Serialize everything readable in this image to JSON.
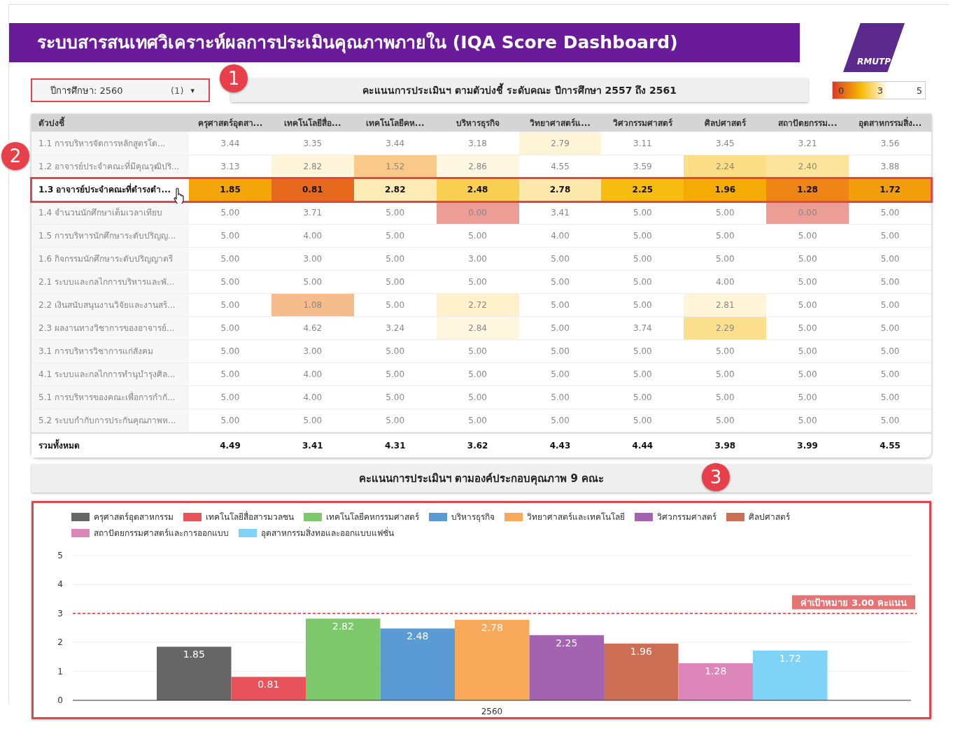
{
  "header": {
    "title": "ระบบสารสนเทศวิเคราะห์ผลการประเมินคุณภาพภายใน (IQA Score Dashboard)",
    "logo": "RMUTP"
  },
  "filter": {
    "label": "ปีการศึกษา: 2560",
    "count": "(1)",
    "caret": "▾"
  },
  "table_title": "คะแนนการประเมินฯ ตามตัวบ่งชี้ ระดับคณะ ปีการศึกษา 2557 ถึง 2561",
  "color_scale": {
    "labels": [
      "0",
      "3",
      "5"
    ]
  },
  "table": {
    "columns": [
      "ตัวบ่งชี้",
      "ครุศาสตร์อุตสา...",
      "เทคโนโลยีสื่อ...",
      "เทคโนโลยีคห...",
      "บริหารธุรกิจ",
      "วิทยาศาสตร์แ...",
      "วิศวกรรมศาสตร์",
      "ศิลปศาสตร์",
      "สถาปัตยกรรม...",
      "อุตสาหกรรมสิ่ง..."
    ],
    "rows": [
      {
        "label": "1.1 การบริหารจัดการหลักสูตรโด...",
        "selected": false,
        "values": [
          "3.44",
          "3.35",
          "3.44",
          "3.18",
          "2.79",
          "3.11",
          "3.45",
          "3.21",
          "3.56"
        ]
      },
      {
        "label": "1.2 อาจารย์ประจำคณะที่มีคุณวุฒิปริ...",
        "selected": false,
        "values": [
          "3.13",
          "2.82",
          "1.52",
          "2.86",
          "4.55",
          "3.59",
          "2.24",
          "2.40",
          "3.88"
        ]
      },
      {
        "label": "1.3 อาจารย์ประจำคณะที่ดำรงตำ...",
        "selected": true,
        "values": [
          "1.85",
          "0.81",
          "2.82",
          "2.48",
          "2.78",
          "2.25",
          "1.96",
          "1.28",
          "1.72"
        ]
      },
      {
        "label": "1.4 จำนวนนักศึกษาเต็มเวลาเทียบ",
        "selected": false,
        "values": [
          "5.00",
          "3.71",
          "5.00",
          "0.00",
          "3.41",
          "5.00",
          "5.00",
          "0.00",
          "5.00"
        ]
      },
      {
        "label": "1.5 การบริหารนักศึกษาระดับปริญญ...",
        "selected": false,
        "values": [
          "5.00",
          "4.00",
          "5.00",
          "5.00",
          "4.00",
          "5.00",
          "5.00",
          "5.00",
          "5.00"
        ]
      },
      {
        "label": "1.6 กิจกรรมนักศึกษาระดับปริญญาตรี",
        "selected": false,
        "values": [
          "5.00",
          "3.00",
          "5.00",
          "3.00",
          "5.00",
          "5.00",
          "5.00",
          "5.00",
          "5.00"
        ]
      },
      {
        "label": "2.1 ระบบและกลไกการบริหารและพั...",
        "selected": false,
        "values": [
          "5.00",
          "5.00",
          "5.00",
          "5.00",
          "5.00",
          "5.00",
          "4.00",
          "5.00",
          "5.00"
        ]
      },
      {
        "label": "2.2 เงินสนับสนุนงานวิจัยและงานสร้...",
        "selected": false,
        "values": [
          "5.00",
          "1.08",
          "5.00",
          "2.72",
          "5.00",
          "5.00",
          "2.81",
          "5.00",
          "5.00"
        ]
      },
      {
        "label": "2.3 ผลงานทางวิชาการของอาจารย์...",
        "selected": false,
        "values": [
          "5.00",
          "4.62",
          "3.24",
          "2.84",
          "5.00",
          "3.74",
          "2.29",
          "5.00",
          "5.00"
        ]
      },
      {
        "label": "3.1 การบริหารวิชาการแก่สังคม",
        "selected": false,
        "values": [
          "5.00",
          "3.00",
          "5.00",
          "5.00",
          "5.00",
          "5.00",
          "5.00",
          "5.00",
          "5.00"
        ]
      },
      {
        "label": "4.1 ระบบและกลไกการทำนุบำรุงศิล...",
        "selected": false,
        "values": [
          "5.00",
          "4.00",
          "5.00",
          "5.00",
          "5.00",
          "5.00",
          "5.00",
          "5.00",
          "5.00"
        ]
      },
      {
        "label": "5.1 การบริหารของคณะเพื่อการกำกั...",
        "selected": false,
        "values": [
          "5.00",
          "4.00",
          "5.00",
          "5.00",
          "5.00",
          "5.00",
          "5.00",
          "5.00",
          "5.00"
        ]
      },
      {
        "label": "5.2 ระบบกำกับการประกันคุณภาพห...",
        "selected": false,
        "values": [
          "5.00",
          "5.00",
          "5.00",
          "5.00",
          "5.00",
          "5.00",
          "5.00",
          "5.00",
          "5.00"
        ]
      }
    ],
    "total": {
      "label": "รวมทั้งหมด",
      "values": [
        "4.49",
        "3.41",
        "4.31",
        "3.62",
        "4.43",
        "4.44",
        "3.98",
        "3.99",
        "4.55"
      ]
    }
  },
  "chart_title": "คะแนนการประเมินฯ ตามองค์ประกอบคุณภาพ 9 คณะ",
  "callouts": [
    "1",
    "2",
    "3"
  ],
  "chart_data": {
    "type": "bar",
    "categories": [
      "2560"
    ],
    "yticks": [
      0,
      1,
      2,
      3,
      4,
      5
    ],
    "ylim": [
      0,
      5
    ],
    "data_labels": true,
    "series": [
      {
        "name": "ครุศาสตร์อุตสาหกรรม",
        "color": "#666666",
        "values": [
          1.85
        ]
      },
      {
        "name": "เทคโนโลยีสื่อสารมวลชน",
        "color": "#e8525a",
        "values": [
          0.81
        ]
      },
      {
        "name": "เทคโนโลยีคหกรรมศาสตร์",
        "color": "#7cc86a",
        "values": [
          2.82
        ]
      },
      {
        "name": "บริหารธุรกิจ",
        "color": "#5b9bd5",
        "values": [
          2.48
        ]
      },
      {
        "name": "วิทยาศาสตร์และเทคโนโลยี",
        "color": "#f8a95a",
        "values": [
          2.78
        ]
      },
      {
        "name": "วิศวกรรมศาสตร์",
        "color": "#a463b0",
        "values": [
          2.25
        ]
      },
      {
        "name": "ศิลปศาสตร์",
        "color": "#cc6f55",
        "values": [
          1.96
        ]
      },
      {
        "name": "สถาปัตยกรรมศาสตร์และการออกแบบ",
        "color": "#dd86b9",
        "values": [
          1.28
        ]
      },
      {
        "name": "อุตสาหกรรมสิ่งทอและออกแบบแฟชั่น",
        "color": "#7fd3f7",
        "values": [
          1.72
        ]
      }
    ],
    "grid": true,
    "legend": "top",
    "ref_lines": [
      {
        "axis": "y",
        "value": 3,
        "label": "ค่าเป้าหมาย 3.00 คะแนน",
        "color": "#d9363e"
      }
    ]
  }
}
